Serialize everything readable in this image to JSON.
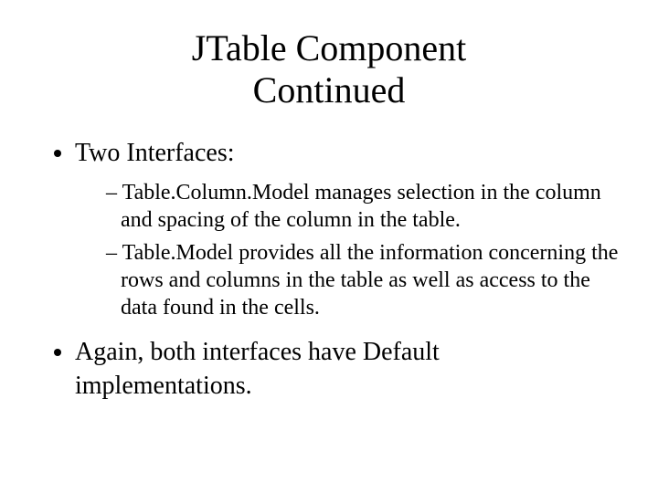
{
  "title_line1": "JTable Component",
  "title_line2": "Continued",
  "bullets": {
    "b1": "Two Interfaces:",
    "b1_sub": {
      "s1": "Table.Column.Model manages selection in the column and spacing of the column in the table.",
      "s2": "Table.Model provides all the information concerning the rows and columns in the table as well as access to the data found in the cells."
    },
    "b2": "Again, both interfaces have Default implementations."
  }
}
